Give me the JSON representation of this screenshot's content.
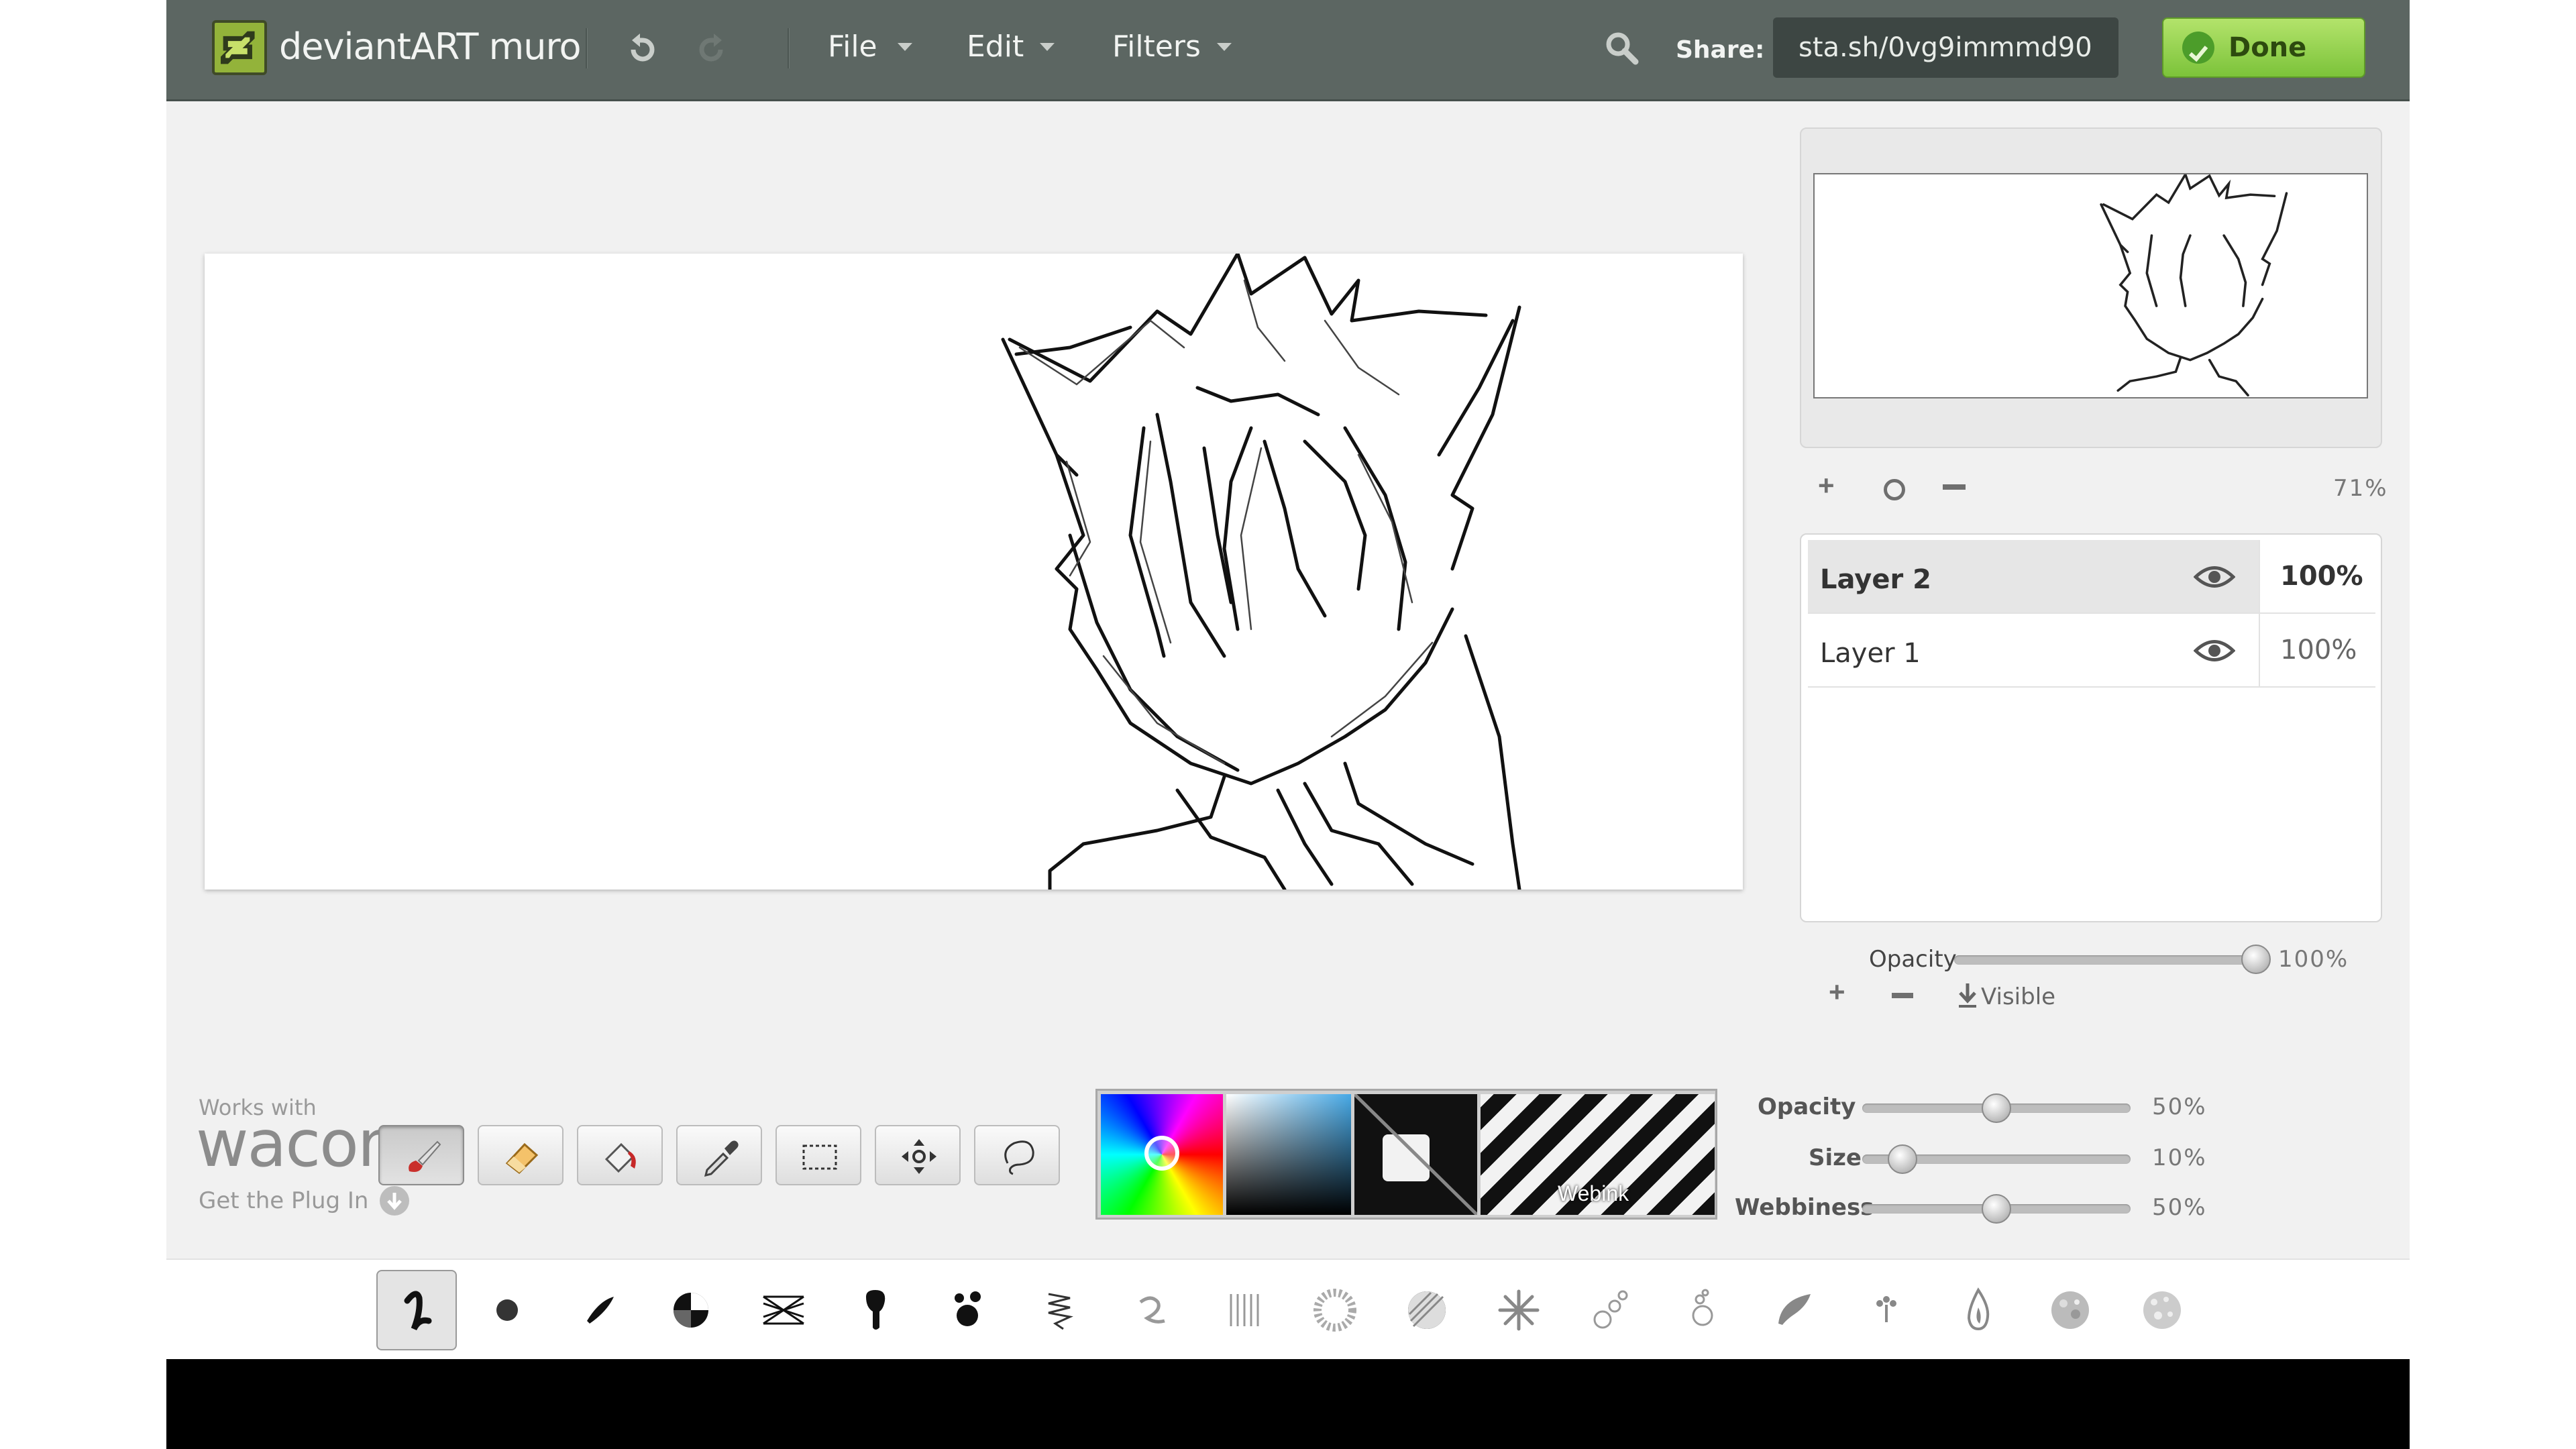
{
  "app": {
    "logo_text": "deviantART muro",
    "menus": [
      "File",
      "Edit",
      "Filters"
    ],
    "share_label": "Share:",
    "share_url": "sta.sh/0vg9immmd90",
    "done_label": "Done"
  },
  "navigator": {
    "zoom": "71%"
  },
  "layers": [
    {
      "name": "Layer 2",
      "opacity": "100%",
      "selected": true
    },
    {
      "name": "Layer 1",
      "opacity": "100%",
      "selected": false
    }
  ],
  "layer_opacity": {
    "label": "Opacity",
    "value": "100%",
    "level": 1.0
  },
  "layer_actions": {
    "visible_label": "Visible"
  },
  "wacom": {
    "works_with": "Works with",
    "brand": "wacom",
    "plugin": "Get the Plug In"
  },
  "tools": [
    "brush-tool",
    "eraser-tool",
    "fill-tool",
    "eyedropper-tool",
    "select-tool",
    "move-tool",
    "lasso-tool"
  ],
  "palette": {
    "webink_label": "Webink"
  },
  "brush_settings": [
    {
      "label": "Opacity",
      "value": "50%",
      "level": 0.5
    },
    {
      "label": "Size",
      "value": "10%",
      "level": 0.1
    },
    {
      "label": "Webbiness",
      "value": "50%",
      "level": 0.5
    }
  ],
  "colors": {
    "topbar": "#5c6662",
    "done_green": "#8fd04a",
    "logo_green": "#93b33a"
  }
}
